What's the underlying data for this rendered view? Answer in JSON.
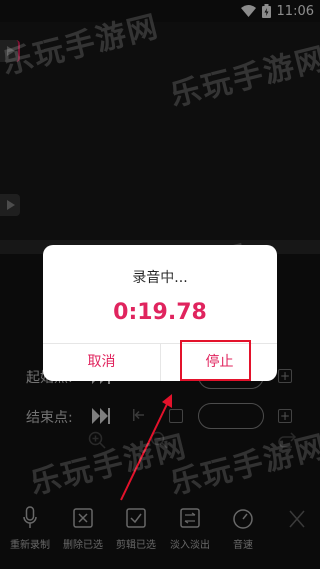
{
  "status": {
    "time": "11:06"
  },
  "editor": {
    "start_label": "起始点:",
    "end_label": "结束点:"
  },
  "toolbar": {
    "items": [
      {
        "label": "重新录制",
        "icon": "microphone-icon"
      },
      {
        "label": "删除已选",
        "icon": "delete-selection-icon"
      },
      {
        "label": "剪辑已选",
        "icon": "trim-selection-icon"
      },
      {
        "label": "淡入淡出",
        "icon": "fade-icon"
      },
      {
        "label": "音速",
        "icon": "speed-icon"
      }
    ]
  },
  "dialog": {
    "title": "录音中...",
    "timer": "0:19.78",
    "cancel_label": "取消",
    "stop_label": "停止"
  },
  "watermark": {
    "text": "乐玩手游网"
  },
  "colors": {
    "accent": "#e0245e",
    "highlight": "#e3122b",
    "background": "#141414"
  }
}
